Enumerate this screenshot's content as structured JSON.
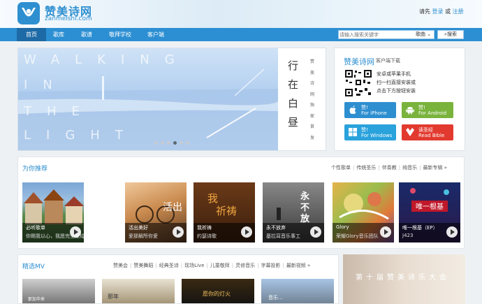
{
  "header": {
    "logo_name": "赞美诗网",
    "logo_domain": "zanmeishi.com",
    "login_prompt": "请先",
    "login": "登录",
    "or": "或",
    "register": "注册"
  },
  "nav": {
    "items": [
      "首页",
      "歌库",
      "歌谱",
      "敬拜学校",
      "客户端"
    ]
  },
  "search": {
    "placeholder": "请输入搜索关键字",
    "type_selected": "歌曲",
    "button": "搜索"
  },
  "banner": {
    "text_walking": "WALKING",
    "text_in": "IN",
    "text_the": "THE",
    "text_light": "LIGHT",
    "poem_title": "行在白昼",
    "poem_side": "赞美诗网独家首发",
    "active_slide": 4,
    "slide_count": 6
  },
  "app": {
    "title": "赞美诗网",
    "subtitle": "客户端下载",
    "qr_line1": "安卓或苹果手机",
    "qr_line2": "扫一扫直接安装或",
    "qr_line3": "点击下方按钮安装",
    "buttons": [
      {
        "l1": "赞!",
        "l2": "For iPhone",
        "color": "#2e8fd0",
        "icon": "apple-icon"
      },
      {
        "l1": "赞!",
        "l2": "For Android",
        "color": "#79b33c",
        "icon": "android-icon"
      },
      {
        "l1": "赞!",
        "l2": "For Windows",
        "color": "#2aa2dc",
        "icon": "windows-icon"
      },
      {
        "l1": "读圣经",
        "l2": "Read Bible",
        "color": "#e23a2f",
        "icon": "bible-icon"
      }
    ]
  },
  "recommend": {
    "title": "为你推荐",
    "links": [
      "个性歌单",
      "传统圣乐",
      "伴奏教",
      "纯音乐",
      "最新专辑 »"
    ],
    "albums": [
      {
        "title": "必听歌单",
        "sub": "你赐我以心，我愿完全献给于你"
      },
      {
        "title": "活出美好",
        "sub": "爱那解所你爱"
      },
      {
        "title": "我祈祷",
        "sub": "约瑟诗歌"
      },
      {
        "title": "永不放弃",
        "sub": "基拉耳音乐事工"
      },
      {
        "title": "Glory",
        "sub": "荣耀Glory音乐团队"
      },
      {
        "title": "唯一根基（EP）",
        "sub": "J423"
      }
    ]
  },
  "mv": {
    "title": "精选MV",
    "links": [
      "赞美会",
      "赞美舞蹈",
      "经典圣诗",
      "现场Live",
      "儿童敬拜",
      "灵修音乐",
      "字幕投影",
      "最新视频 »"
    ],
    "thumb_texts": [
      "那加华来",
      "那年",
      "愿你的灯火",
      "音乐..."
    ]
  },
  "promo": {
    "text": "第十届赞美诗乐大会"
  },
  "colors": {
    "brand": "#2e8fd0",
    "nav": "#2c8fd3"
  }
}
